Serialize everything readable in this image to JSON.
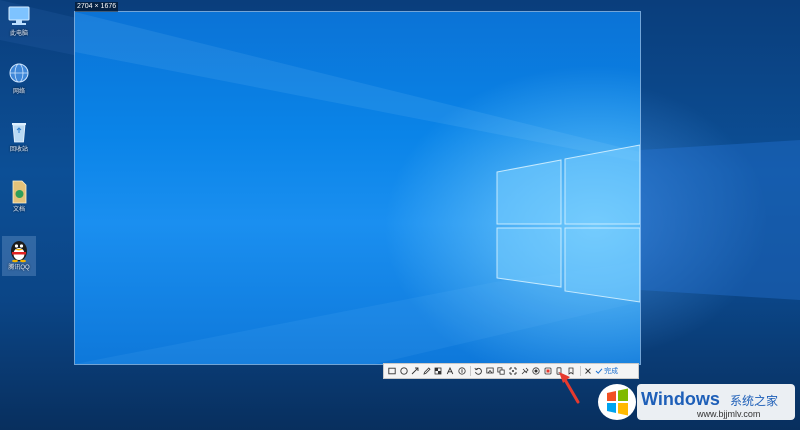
{
  "desktop": {
    "icons": [
      {
        "label": "此电脑",
        "icon": "computer-icon"
      },
      {
        "label": "网络",
        "icon": "network-icon"
      },
      {
        "label": "回收站",
        "icon": "recycle-bin-icon"
      },
      {
        "label": "文档",
        "icon": "document-icon"
      },
      {
        "label": "腾讯QQ",
        "icon": "qq-penguin-icon"
      }
    ]
  },
  "capture": {
    "dimensions": "2704 × 1676"
  },
  "toolbar": {
    "tools": [
      "rectangle-icon",
      "ellipse-icon",
      "arrow-icon",
      "pencil-icon",
      "mosaic-icon",
      "text-icon",
      "number-marker-icon",
      "undo-icon",
      "pin-to-screen-icon",
      "translate-icon",
      "long-screenshot-icon",
      "record-icon",
      "screen-record-icon",
      "ocr-icon",
      "save-icon",
      "phone-icon",
      "bookmark-icon",
      "close-icon"
    ],
    "done_label": "完成"
  },
  "colors": {
    "accent": "#1a6fd0",
    "arrow": "#e53a2f",
    "wallpaper_dark": "#0a3e7c",
    "wallpaper_light": "#0a84e8"
  },
  "watermark": {
    "brand": "Windows",
    "brand_cn": "系统之家",
    "url": "www.bjjmlv.com"
  }
}
